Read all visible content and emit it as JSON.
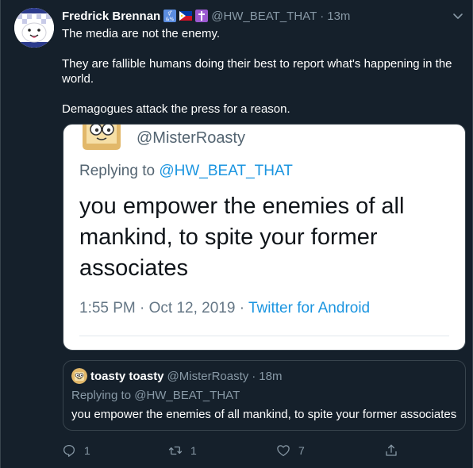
{
  "tweet": {
    "author_name": "Fredrick Brennan",
    "handle": "@HW_BEAT_THAT",
    "separator": "·",
    "time": "13m",
    "paragraphs": [
      "The media are not the enemy.",
      "They are fallible humans doing their best to report what's happening in the world.",
      "Demagogues attack the press for a reason."
    ],
    "header_emojis": [
      "accessibility-symbols-icon",
      "philippines-flag-icon",
      "latin-cross-icon"
    ]
  },
  "screenshot": {
    "handle": "@MisterRoasty",
    "replying_prefix": "Replying to ",
    "replying_handle": "@HW_BEAT_THAT",
    "body": "you empower the enemies of all mankind, to spite your former associates",
    "timestamp": "1:55 PM · Oct 12, 2019",
    "separator": " · ",
    "source": "Twitter for Android"
  },
  "quote": {
    "name": "toasty toasty",
    "handle": "@MisterRoasty",
    "separator": "·",
    "time": "18m",
    "replying": "Replying to @HW_BEAT_THAT",
    "text": "you empower the enemies of all mankind, to spite your former associates"
  },
  "actions": {
    "reply_count": "1",
    "retweet_count": "1",
    "like_count": "7"
  },
  "colors": {
    "background": "#15202b",
    "border": "#38444d",
    "muted": "#8899a6",
    "link": "#1b95e0"
  }
}
